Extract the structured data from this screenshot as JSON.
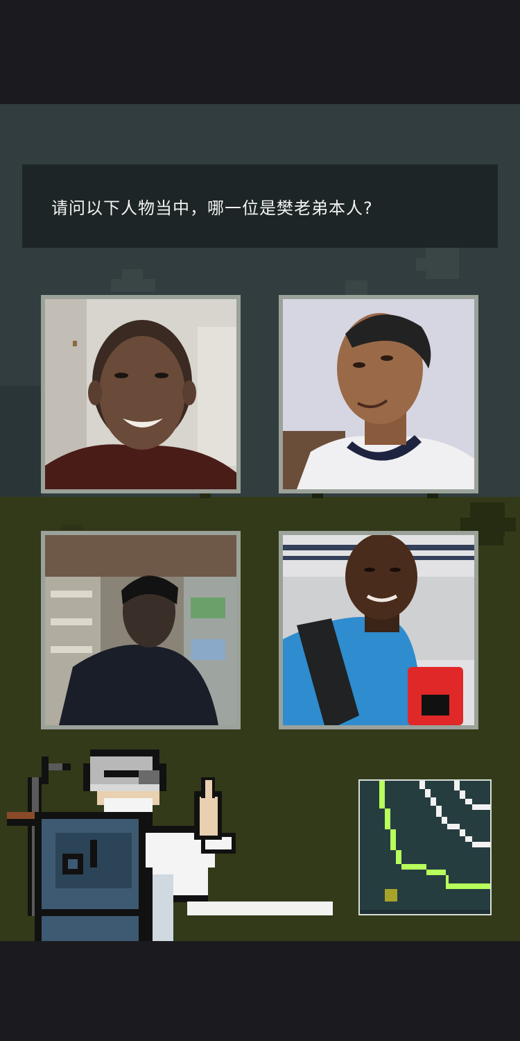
{
  "question": {
    "text": "请问以下人物当中，哪一位是樊老弟本人?"
  },
  "options": [
    {
      "id": "option-1",
      "icon": "photo-shaved-head-smiling-man"
    },
    {
      "id": "option-2",
      "icon": "photo-man-white-jersey"
    },
    {
      "id": "option-3",
      "icon": "photo-man-in-store"
    },
    {
      "id": "option-4",
      "icon": "photo-man-blue-shirt-backpack"
    }
  ],
  "colors": {
    "sky": "#313d3e",
    "ground": "#333a19",
    "question_box": "#1d2526",
    "photo_border": "#9aa29a",
    "minimap_path": "#b7ff5c",
    "minimap_player": "#a8a22a"
  },
  "character": {
    "icon": "old-man-with-backpack-icon"
  },
  "minimap": {
    "icon": "minimap-icon"
  }
}
